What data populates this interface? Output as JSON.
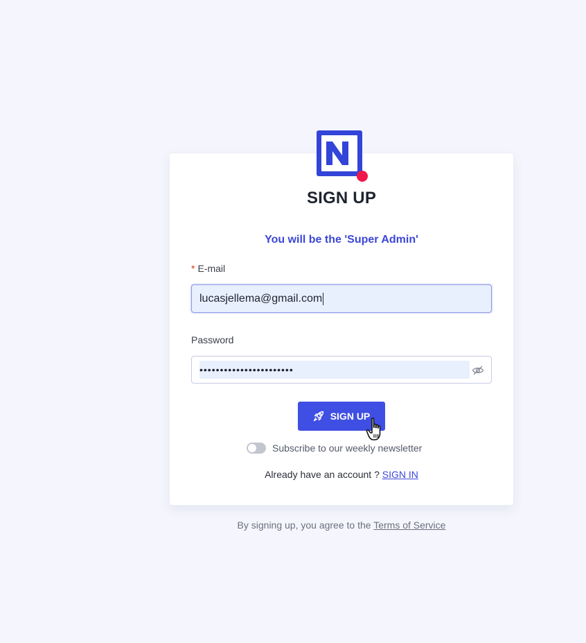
{
  "header": {
    "title": "SIGN UP",
    "subtitle": "You will be the 'Super Admin'",
    "logo_icon": "nocodb-logo-icon"
  },
  "form": {
    "email": {
      "label": "E-mail",
      "required_marker": "*",
      "value": "lucasjellema@gmail.com"
    },
    "password": {
      "label": "Password",
      "masked_value": "•••••••••••••••••••••••",
      "toggle_icon": "eye-slash-icon"
    },
    "submit": {
      "label": "SIGN UP",
      "icon": "rocket-icon"
    },
    "newsletter": {
      "label": "Subscribe to our weekly newsletter",
      "checked": false
    }
  },
  "footer": {
    "already_text": "Already have an account ?",
    "signin_link": "SIGN IN",
    "terms_prefix": "By signing up, you agree to the",
    "terms_link": "Terms of Service"
  },
  "colors": {
    "accent": "#3f4fe3",
    "background": "#f5f6fd",
    "logo_dot": "#f0184a"
  }
}
